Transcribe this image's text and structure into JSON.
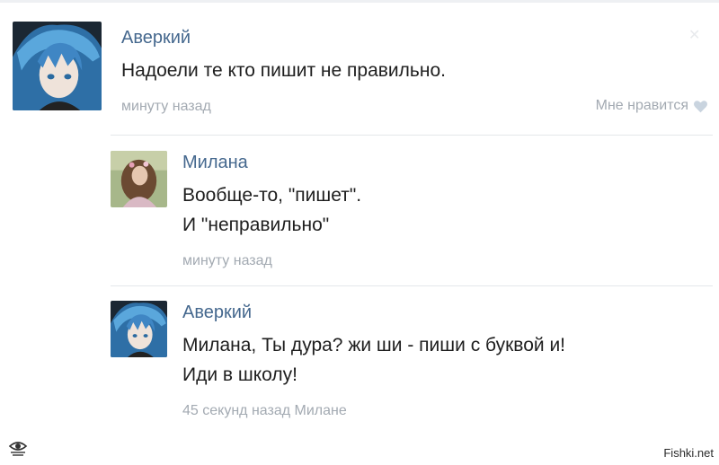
{
  "comments": [
    {
      "author": "Аверкий",
      "lines": [
        "Надоели те кто пишит не правильно."
      ],
      "time": "минуту назад",
      "like_label": "Мне нравится",
      "avatar_icon": "anime-boy-avatar"
    },
    {
      "author": "Милана",
      "lines": [
        "Вообще-то, \"пишет\".",
        "И \"неправильно\""
      ],
      "time": "минуту назад",
      "avatar_icon": "girl-photo-avatar"
    },
    {
      "author": "Аверкий",
      "lines": [
        "Милана, Ты дура? жи ши - пиши с буквой и!",
        "Иди в школу!"
      ],
      "time": "45 секунд назад",
      "reply_to": "Милане",
      "avatar_icon": "anime-boy-avatar"
    }
  ],
  "watermark": "Fishki.net",
  "colors": {
    "author": "#45688e",
    "text": "#1e1e1e",
    "meta": "#a3aab2",
    "divider": "#e4e7ea"
  }
}
